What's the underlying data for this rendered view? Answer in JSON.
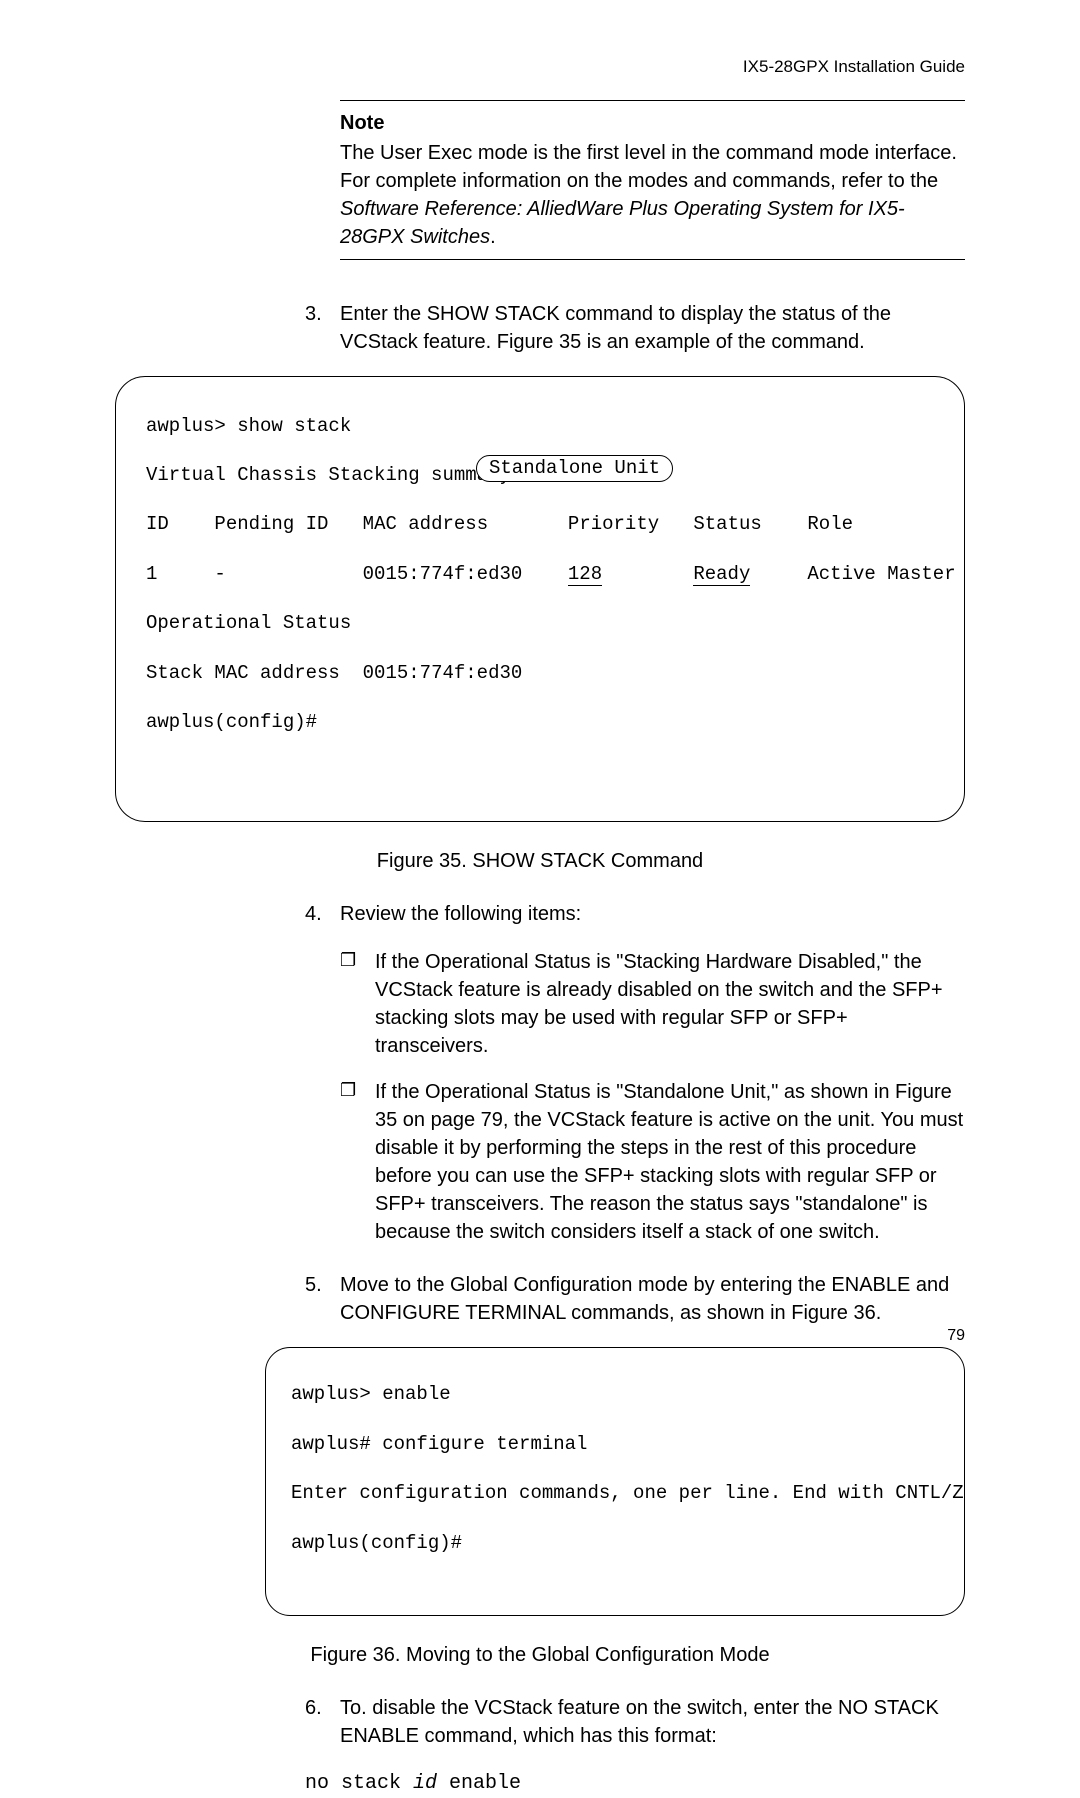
{
  "header": "IX5-28GPX Installation Guide",
  "note": {
    "title": "Note",
    "text_pre": "The User Exec mode is the first level in the command mode interface. For complete information on the modes and commands, refer to the ",
    "text_italic": "Software Reference: AlliedWare Plus Operating System for IX5-28GPX Switches",
    "text_post": "."
  },
  "step3": {
    "num": "3.",
    "text": "Enter the SHOW STACK command to display the status of the VCStack feature. Figure 35 is an example of the command."
  },
  "terminal1": {
    "line1": "awplus> show stack",
    "line2": "Virtual Chassis Stacking summary information",
    "hdr_id": "ID",
    "hdr_pending": "Pending ID",
    "hdr_mac": "MAC address",
    "hdr_priority": "Priority",
    "hdr_status": "Status",
    "hdr_role": "Role",
    "row_id": "1",
    "row_pending": "-",
    "row_mac": "0015:774f:ed30",
    "row_priority": "128",
    "row_status": "Ready",
    "row_role": "Active Master",
    "opstatus_label": "Operational Status",
    "opstatus_value": "Standalone Unit",
    "stackmac_label": "Stack MAC address",
    "stackmac_value": "0015:774f:ed30",
    "prompt": "awplus(config)#"
  },
  "figure35": "Figure 35. SHOW STACK Command",
  "step4": {
    "num": "4.",
    "text": "Review the following items:"
  },
  "bullets": {
    "b1": "If the Operational Status is \"Stacking Hardware Disabled,\" the VCStack feature is already disabled on the switch and the SFP+ stacking slots may be used with regular SFP or SFP+ transceivers.",
    "b2": "If the Operational Status is \"Standalone Unit,\" as shown in Figure 35 on page 79, the VCStack feature is active on the unit. You must disable it by performing the steps in the rest of this procedure before you can use the SFP+ stacking slots with regular SFP or SFP+ transceivers. The reason the status says \"standalone\" is because the switch considers itself a stack of one switch."
  },
  "step5": {
    "num": "5.",
    "text": "Move to the Global Configuration mode by entering the ENABLE and CONFIGURE TERMINAL commands, as shown in Figure 36."
  },
  "terminal2": {
    "line1": "awplus> enable",
    "line2": "awplus# configure terminal",
    "line3": "Enter configuration commands, one per line. End with CNTL/Z",
    "line4": "awplus(config)#"
  },
  "figure36": "Figure 36. Moving to the Global Configuration Mode",
  "step6": {
    "num": "6.",
    "text": "To. disable the VCStack feature on the switch, enter the NO STACK ENABLE command, which has this format:"
  },
  "code": {
    "pre": "no stack ",
    "id": "id",
    "post": " enable"
  },
  "page": "79"
}
